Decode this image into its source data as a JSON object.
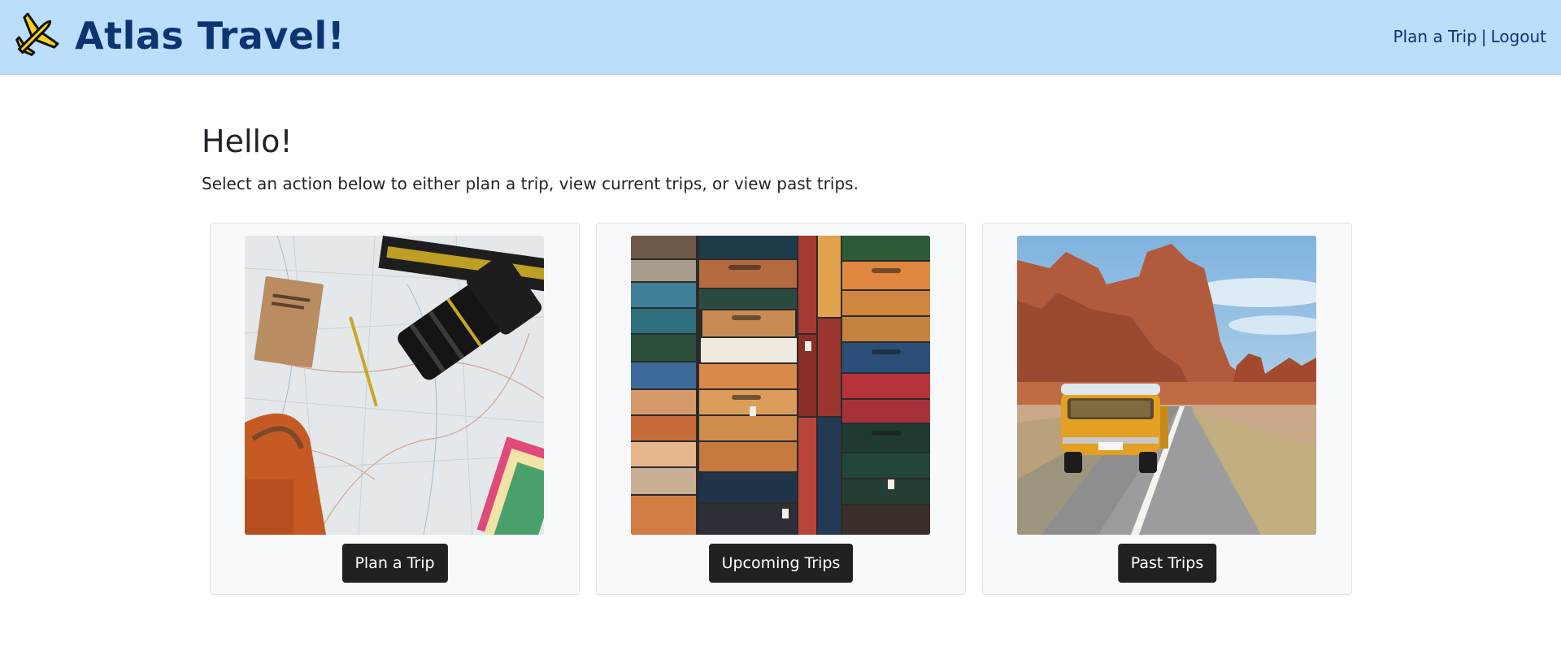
{
  "navbar": {
    "brand": "Atlas Travel!",
    "logo_icon": "airplane-icon",
    "links": {
      "plan_trip": "Plan a Trip",
      "separator": "|",
      "logout": "Logout"
    },
    "background_color": "#bbdefb",
    "text_color": "#0d3470"
  },
  "main": {
    "greeting": "Hello!",
    "subtitle": "Select an action below to either plan a trip, view current trips, or view past trips.",
    "cards": [
      {
        "image": "map-camera-flatlay-photo",
        "button_label": "Plan a Trip"
      },
      {
        "image": "stacked-suitcases-photo",
        "button_label": "Upcoming Trips"
      },
      {
        "image": "desert-road-van-photo",
        "button_label": "Past Trips"
      }
    ]
  },
  "colors": {
    "button_background": "#212121",
    "card_background": "#f8f9fa"
  }
}
